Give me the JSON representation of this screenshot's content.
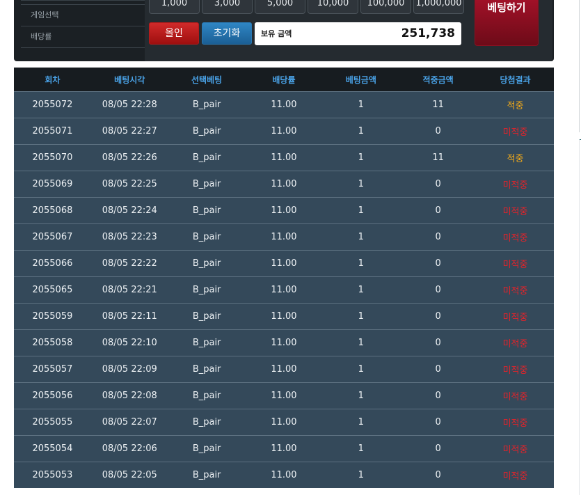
{
  "side_menu": {
    "items": [
      "게임선택",
      "배당률"
    ]
  },
  "chips": [
    "1,000",
    "3,000",
    "5,000",
    "10,000",
    "100,000",
    "1,000,000"
  ],
  "buttons": {
    "all_in": "올인",
    "reset": "초기화",
    "bet": "베팅하기"
  },
  "balance": {
    "label": "보유 금액",
    "value": "251,738"
  },
  "table": {
    "headers": [
      "회차",
      "베팅시각",
      "선택베팅",
      "배당률",
      "베팅금액",
      "적중금액",
      "당첨결과"
    ],
    "rows": [
      [
        "2055072",
        "08/05 22:28",
        "B_pair",
        "11.00",
        "1",
        "11",
        "적중"
      ],
      [
        "2055071",
        "08/05 22:27",
        "B_pair",
        "11.00",
        "1",
        "0",
        "미적중"
      ],
      [
        "2055070",
        "08/05 22:26",
        "B_pair",
        "11.00",
        "1",
        "11",
        "적중"
      ],
      [
        "2055069",
        "08/05 22:25",
        "B_pair",
        "11.00",
        "1",
        "0",
        "미적중"
      ],
      [
        "2055068",
        "08/05 22:24",
        "B_pair",
        "11.00",
        "1",
        "0",
        "미적중"
      ],
      [
        "2055067",
        "08/05 22:23",
        "B_pair",
        "11.00",
        "1",
        "0",
        "미적중"
      ],
      [
        "2055066",
        "08/05 22:22",
        "B_pair",
        "11.00",
        "1",
        "0",
        "미적중"
      ],
      [
        "2055065",
        "08/05 22:21",
        "B_pair",
        "11.00",
        "1",
        "0",
        "미적중"
      ],
      [
        "2055059",
        "08/05 22:11",
        "B_pair",
        "11.00",
        "1",
        "0",
        "미적중"
      ],
      [
        "2055058",
        "08/05 22:10",
        "B_pair",
        "11.00",
        "1",
        "0",
        "미적중"
      ],
      [
        "2055057",
        "08/05 22:09",
        "B_pair",
        "11.00",
        "1",
        "0",
        "미적중"
      ],
      [
        "2055056",
        "08/05 22:08",
        "B_pair",
        "11.00",
        "1",
        "0",
        "미적중"
      ],
      [
        "2055055",
        "08/05 22:07",
        "B_pair",
        "11.00",
        "1",
        "0",
        "미적중"
      ],
      [
        "2055054",
        "08/05 22:06",
        "B_pair",
        "11.00",
        "1",
        "0",
        "미적중"
      ],
      [
        "2055053",
        "08/05 22:05",
        "B_pair",
        "11.00",
        "1",
        "0",
        "미적중"
      ]
    ]
  },
  "colors": {
    "header_text": "#4aa3e8",
    "win": "#f0a91a",
    "lose": "#e4232a",
    "row_bg": "#34495a"
  }
}
